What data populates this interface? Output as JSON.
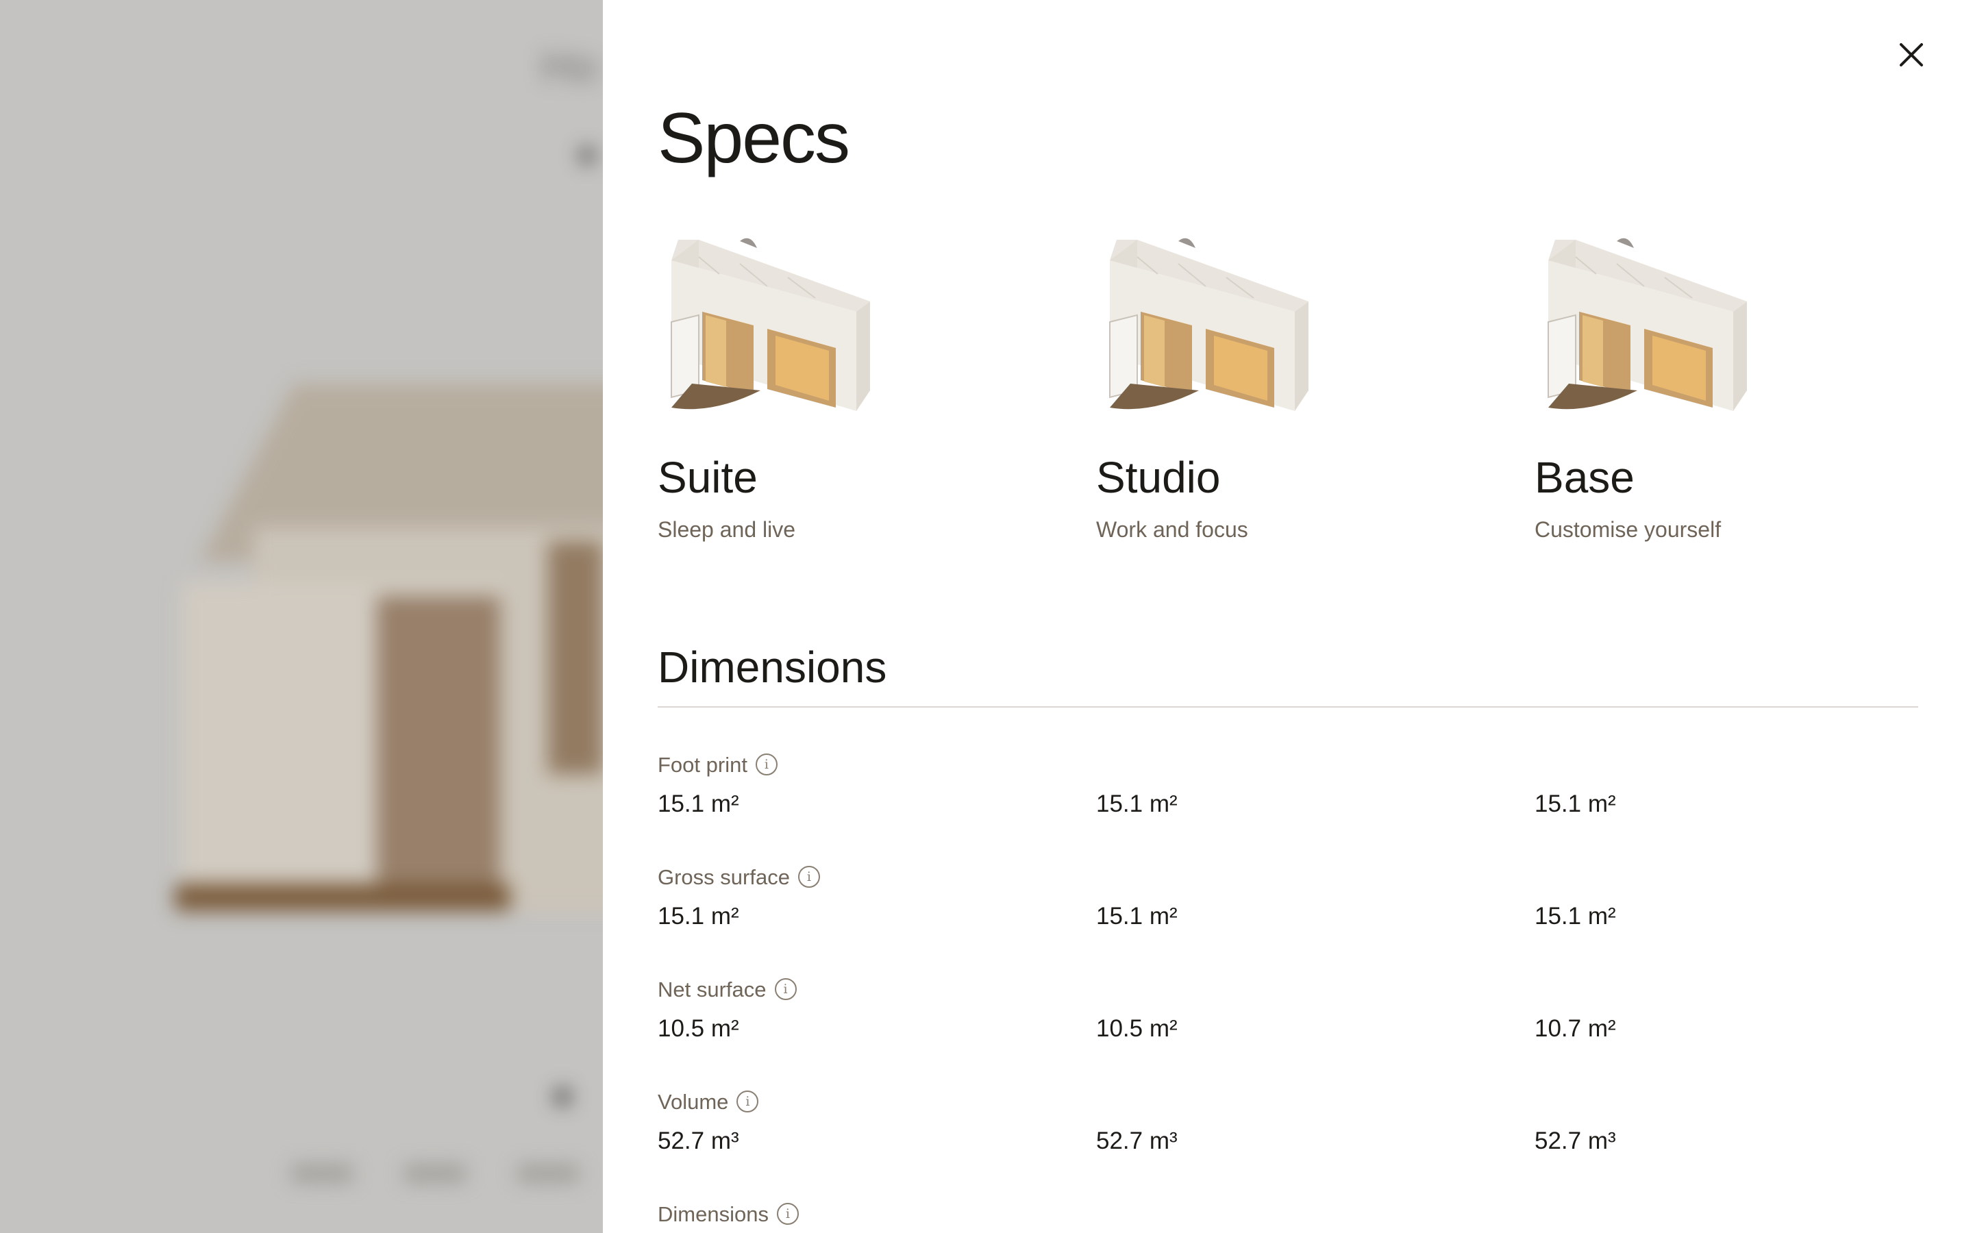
{
  "background": {
    "heading": "Ho"
  },
  "panel": {
    "title": "Specs",
    "close_label": "Close",
    "models": [
      {
        "name": "Suite",
        "tagline": "Sleep and live"
      },
      {
        "name": "Studio",
        "tagline": "Work and focus"
      },
      {
        "name": "Base",
        "tagline": "Customise yourself"
      }
    ],
    "section": "Dimensions",
    "rows": [
      {
        "label": "Foot print",
        "values": [
          "15.1 m²",
          "15.1 m²",
          "15.1 m²"
        ]
      },
      {
        "label": "Gross surface",
        "values": [
          "15.1 m²",
          "15.1 m²",
          "15.1 m²"
        ]
      },
      {
        "label": "Net surface",
        "values": [
          "10.5 m²",
          "10.5 m²",
          "10.7 m²"
        ]
      },
      {
        "label": "Volume",
        "values": [
          "52.7 m³",
          "52.7 m³",
          "52.7 m³"
        ]
      },
      {
        "label": "Dimensions",
        "values": []
      }
    ],
    "info_icon": "info-icon",
    "close_icon": "close-icon",
    "colors": {
      "label": "#6f6458",
      "text": "#1d1b18",
      "divider": "#dcd9d4",
      "wood": "#c89a5c"
    }
  }
}
